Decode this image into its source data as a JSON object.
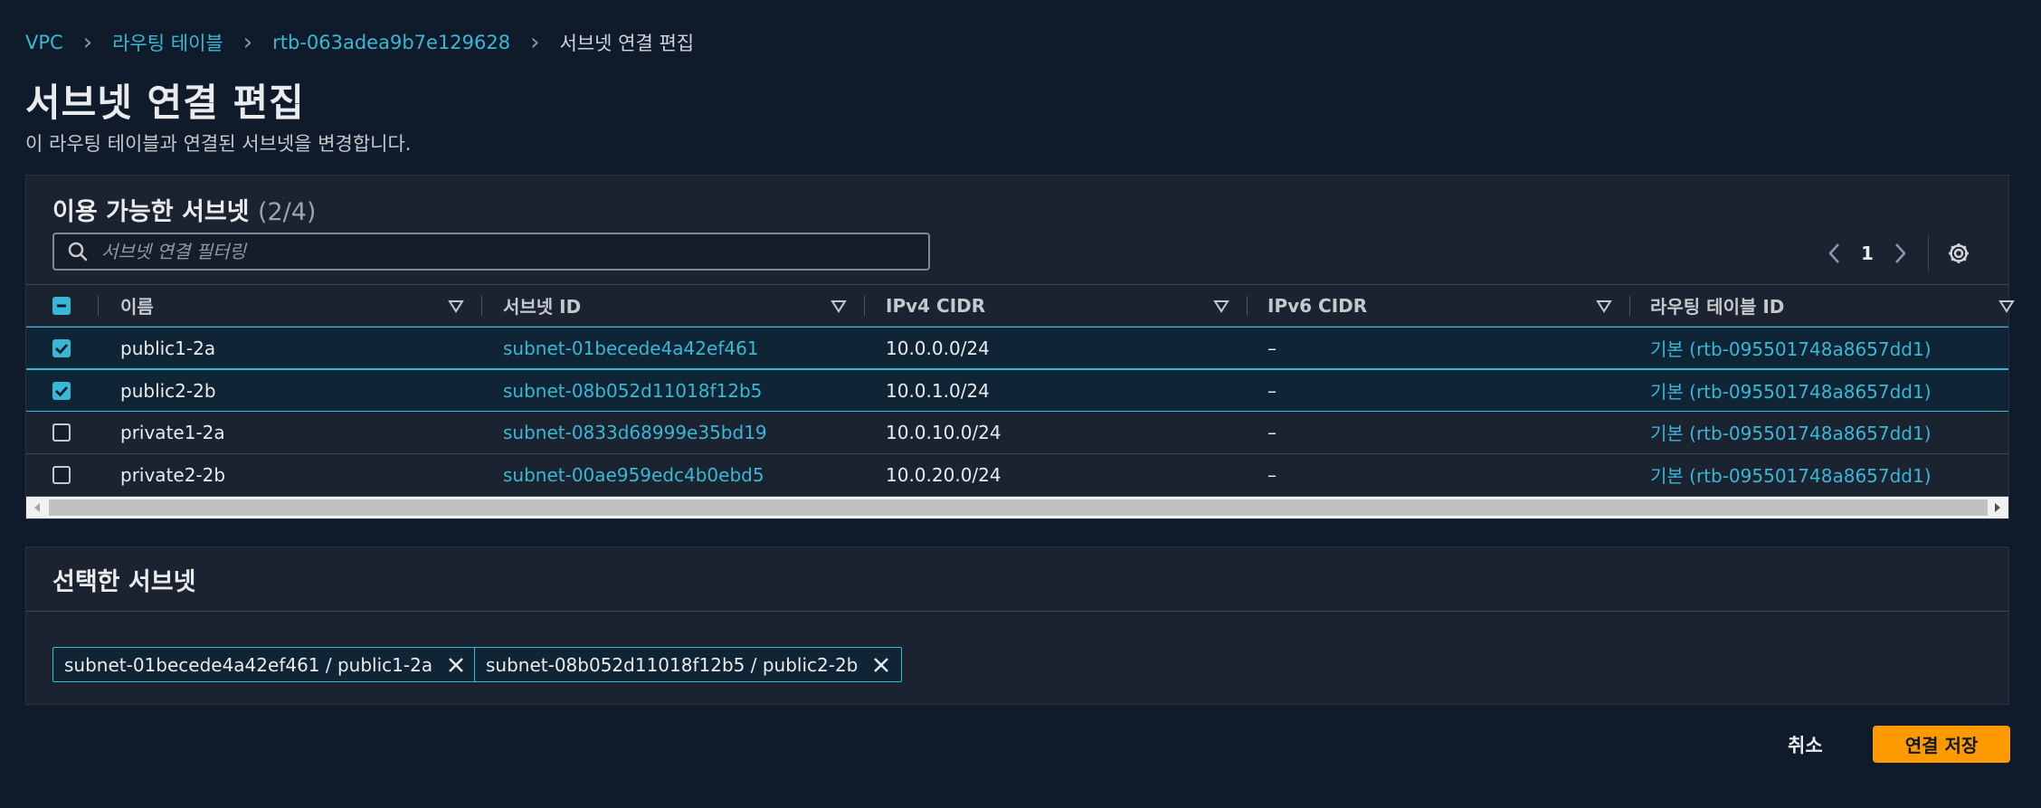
{
  "breadcrumb": {
    "items": [
      "VPC",
      "라우팅 테이블",
      "rtb-063adea9b7e129628"
    ],
    "current": "서브넷 연결 편집"
  },
  "page": {
    "title": "서브넷 연결 편집",
    "description": "이 라우팅 테이블과 연결된 서브넷을 변경합니다."
  },
  "available": {
    "title": "이용 가능한 서브넷",
    "count": "(2/4)",
    "search_placeholder": "서브넷 연결 필터링",
    "search_value": "",
    "page_number": "1",
    "columns": [
      "이름",
      "서브넷 ID",
      "IPv4 CIDR",
      "IPv6 CIDR",
      "라우팅 테이블 ID"
    ],
    "rows": [
      {
        "checked": true,
        "name": "public1-2a",
        "subnet_id": "subnet-01becede4a42ef461",
        "ipv4": "10.0.0.0/24",
        "ipv6": "–",
        "route_table": "기본 (rtb-095501748a8657dd1)"
      },
      {
        "checked": true,
        "name": "public2-2b",
        "subnet_id": "subnet-08b052d11018f12b5",
        "ipv4": "10.0.1.0/24",
        "ipv6": "–",
        "route_table": "기본 (rtb-095501748a8657dd1)"
      },
      {
        "checked": false,
        "name": "private1-2a",
        "subnet_id": "subnet-0833d68999e35bd19",
        "ipv4": "10.0.10.0/24",
        "ipv6": "–",
        "route_table": "기본 (rtb-095501748a8657dd1)"
      },
      {
        "checked": false,
        "name": "private2-2b",
        "subnet_id": "subnet-00ae959edc4b0ebd5",
        "ipv4": "10.0.20.0/24",
        "ipv6": "–",
        "route_table": "기본 (rtb-095501748a8657dd1)"
      }
    ]
  },
  "selected": {
    "title": "선택한 서브넷",
    "tokens": [
      "subnet-01becede4a42ef461 / public1-2a",
      "subnet-08b052d11018f12b5 / public2-2b"
    ]
  },
  "actions": {
    "cancel_label": "취소",
    "save_label": "연결 저장"
  },
  "colors": {
    "background": "#0f1b2a",
    "panel": "#1c2330",
    "link": "#39b8d6",
    "primary_button": "#ff9900"
  },
  "icons": [
    "search-icon",
    "chevron-left-icon",
    "chevron-right-icon",
    "gear-icon",
    "sort-icon",
    "close-icon",
    "checkbox-checked-icon",
    "checkbox-indeterminate-icon"
  ]
}
